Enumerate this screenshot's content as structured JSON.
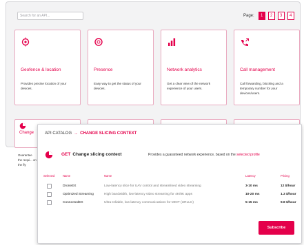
{
  "catalog": {
    "search_placeholder": "Search for an API...",
    "pager": {
      "label": "Page:",
      "pages": [
        "1",
        "2",
        "3",
        "4"
      ],
      "active": "1"
    },
    "cards": [
      {
        "title": "Geofence & location",
        "description": "Provides precise location of your devices.",
        "icon": "location-pin-icon"
      },
      {
        "title": "Presence",
        "description": "Easy way to get the status of your devices.",
        "icon": "presence-icon"
      },
      {
        "title": "Network analytics",
        "description": "Get a clear view of the network experience of your users.",
        "icon": "bar-chart-icon"
      },
      {
        "title": "Call management",
        "description": "Call forwarding, blocking and a temporary number for your devices/users.",
        "icon": "call-management-icon"
      }
    ],
    "partial_cards": [
      {
        "title": "Change",
        "description": "Guarantee the requi... on the fly",
        "icon": "slicing-icon"
      }
    ]
  },
  "panel": {
    "breadcrumb": {
      "root": "API CATALOG",
      "separator": "→",
      "current": "CHANGE SLICING CONTEXT"
    },
    "api": {
      "method": "GET",
      "name": "Change slicing context",
      "description_prefix": "Provides a guaranteed network experience, based on the ",
      "description_link": "selected profile"
    },
    "table": {
      "headers": {
        "selected": "Selected",
        "name": "Name",
        "description": "Name",
        "latency": "Latency",
        "pricing": "Pricing"
      },
      "rows": [
        {
          "name": "DroneEX",
          "description": "Low-latency slice for UAV control and streamlined video streaming",
          "latency": "3-10 ms",
          "price": "12 $/hour"
        },
        {
          "name": "Optimized Streaming",
          "description": "High bandwidth, low-latency video streaming for 4K/8K apps",
          "latency": "10-20 ms",
          "price": "1.3 $/hour"
        },
        {
          "name": "ConnectedEX",
          "description": "Ultra-reliable, low latency communications for MIOT (URLLC)",
          "latency": "5-15 ms",
          "price": "9.8 $/hour"
        }
      ]
    },
    "subscribe_label": "Subscribe"
  },
  "colors": {
    "accent": "#e4004b",
    "card_border": "#e9a9bf"
  }
}
